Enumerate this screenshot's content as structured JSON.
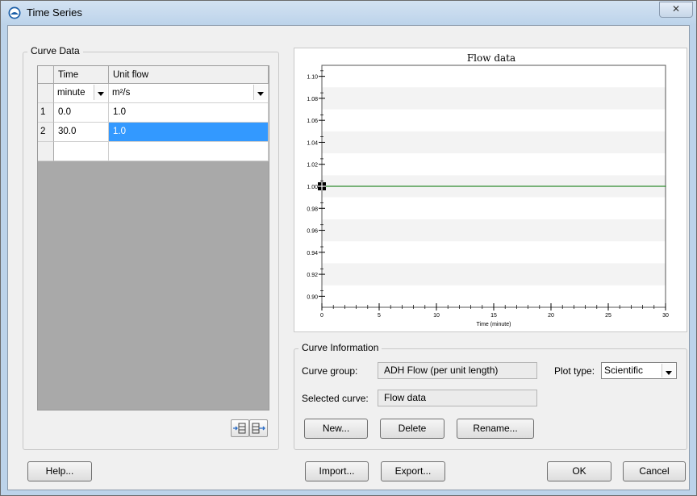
{
  "window": {
    "title": "Time Series",
    "close_glyph": "✕"
  },
  "curve_data": {
    "legend": "Curve Data",
    "columns": [
      "Time",
      "Unit flow"
    ],
    "units": [
      "minute",
      "m²/s"
    ],
    "rows": [
      {
        "index": "1",
        "time": "0.0",
        "value": "1.0"
      },
      {
        "index": "2",
        "time": "30.0",
        "value": "1.0"
      }
    ]
  },
  "chart_data": {
    "type": "line",
    "title": "Flow data",
    "xlabel": "Time (minute)",
    "ylabel": "",
    "xlim": [
      0,
      30
    ],
    "ylim": [
      0.89,
      1.11
    ],
    "x_ticks": [
      "0",
      "5",
      "10",
      "15",
      "20",
      "25",
      "30"
    ],
    "y_ticks": [
      "0.90",
      "0.92",
      "0.94",
      "0.96",
      "0.98",
      "1.00",
      "1.02",
      "1.04",
      "1.06",
      "1.08",
      "1.10"
    ],
    "series": [
      {
        "x": [
          0,
          30
        ],
        "y": [
          1.0,
          1.0
        ],
        "color": "#2e8b2e"
      }
    ],
    "grid": "alternating horizontal bands"
  },
  "curve_info": {
    "legend": "Curve Information",
    "group_label": "Curve group:",
    "group_value": "ADH Flow (per unit length)",
    "plot_type_label": "Plot type:",
    "plot_type_value": "Scientific",
    "selected_label": "Selected curve:",
    "selected_value": "Flow data",
    "new_label": "New...",
    "delete_label": "Delete",
    "rename_label": "Rename..."
  },
  "footer": {
    "help_label": "Help...",
    "import_label": "Import...",
    "export_label": "Export...",
    "ok_label": "OK",
    "cancel_label": "Cancel"
  },
  "icons": {
    "app": "globe-icon",
    "insert_row": "insert-row-icon",
    "add_row": "add-row-icon"
  },
  "colors": {
    "selection": "#3399ff",
    "line": "#2e8b2e",
    "band": "#f3f3f3"
  }
}
